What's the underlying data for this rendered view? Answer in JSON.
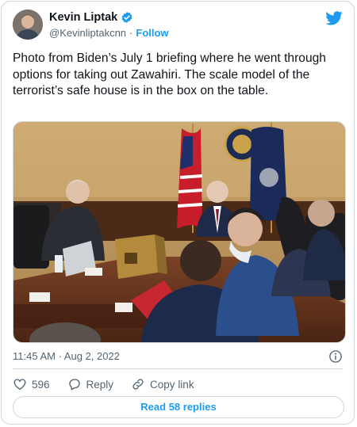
{
  "author": {
    "name": "Kevin Liptak",
    "handle": "@Kevinliptakcnn",
    "separator": "·",
    "follow_label": "Follow"
  },
  "tweet": {
    "text": "Photo from Biden’s July 1 briefing where he went through options for taking out Zawahiri. The scale model of the terrorist’s safe house is in the box on the table.",
    "timestamp": "11:45 AM · Aug 2, 2022"
  },
  "actions": {
    "like_count": "596",
    "reply_label": "Reply",
    "copy_link_label": "Copy link"
  },
  "replies_button": "Read 58 replies",
  "colors": {
    "accent": "#1d9bf0",
    "like": "#f91880",
    "text": "#0f1419",
    "muted": "#536471"
  },
  "icons": [
    "verified-badge-icon",
    "twitter-bird-icon",
    "info-icon",
    "heart-icon",
    "reply-icon",
    "link-icon"
  ]
}
